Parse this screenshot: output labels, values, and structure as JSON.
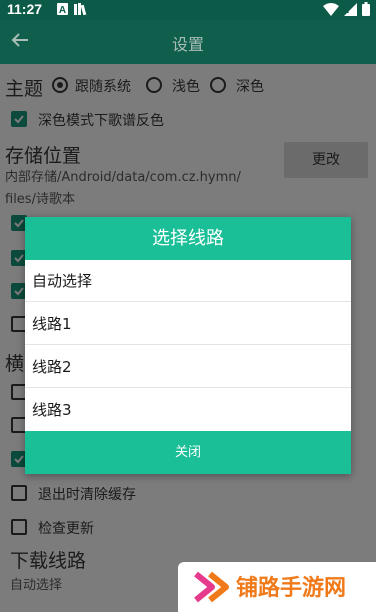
{
  "status_bar": {
    "time": "11:27",
    "left_icons": [
      "a-notification-icon",
      "library-notification-icon"
    ],
    "right_icons": [
      "wifi-icon",
      "signal-icon",
      "battery-icon"
    ]
  },
  "app_bar": {
    "title": "设置",
    "back_icon": "arrow-left-icon"
  },
  "settings": {
    "theme": {
      "label": "主题",
      "options": [
        "跟随系统",
        "浅色",
        "深色"
      ],
      "selected": "跟随系统"
    },
    "dark_invert": {
      "label": "深色模式下歌谱反色",
      "checked": true
    },
    "storage": {
      "label": "存储位置",
      "path_line1": "内部存储/Android/data/com.cz.hymn/",
      "path_line2": "files/诗歌本",
      "change_button": "更改"
    },
    "partial_heading": "横",
    "clear_cache": {
      "label": "退出时清除缓存",
      "checked": false
    },
    "check_update": {
      "label": "检查更新",
      "checked": false
    },
    "download_line": {
      "label": "下载线路",
      "value": "自动选择"
    }
  },
  "dialog": {
    "title": "选择线路",
    "items": [
      "自动选择",
      "线路1",
      "线路2",
      "线路3"
    ],
    "close_button": "关闭"
  },
  "watermark": {
    "text": "铺路手游网"
  },
  "colors": {
    "status_bar": "#0c5b49",
    "app_bar": "#0f5f4c",
    "dialog_accent": "#1bbf97",
    "scrim_background": "#7c7c7c",
    "watermark_text": "#f07a1a"
  }
}
